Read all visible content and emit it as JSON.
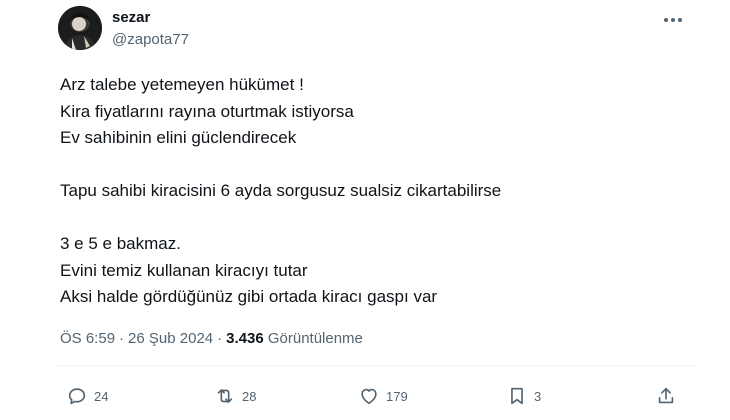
{
  "author": {
    "name": "sezar",
    "handle": "@zapota77"
  },
  "tweet": {
    "lines": [
      "Arz talebe yetemeyen hükümet !",
      "Kira fiyatlarını rayına oturtmak istiyorsa",
      "Ev sahibinin elini güclendirecek",
      "",
      "Tapu sahibi kiracisini 6 ayda sorgusuz sualsiz cikartabilirse",
      "",
      "3 e 5 e bakmaz.",
      "Evini temiz kullanan kiracıyı tutar",
      "Aksi halde gördüğünüz gibi ortada kiracı gaspı var"
    ]
  },
  "meta": {
    "time": "ÖS 6:59",
    "date": "26 Şub 2024",
    "views_count": "3.436",
    "views_label": "Görüntülenme"
  },
  "actions": {
    "replies": "24",
    "retweets": "28",
    "likes": "179",
    "bookmarks": "3"
  },
  "icons": {
    "more": "more-horizontal-icon",
    "reply": "reply-icon",
    "retweet": "retweet-icon",
    "like": "heart-icon",
    "bookmark": "bookmark-icon",
    "share": "share-icon"
  },
  "colors": {
    "text": "#0f1419",
    "secondary": "#536471",
    "divider": "#eff3f4"
  }
}
